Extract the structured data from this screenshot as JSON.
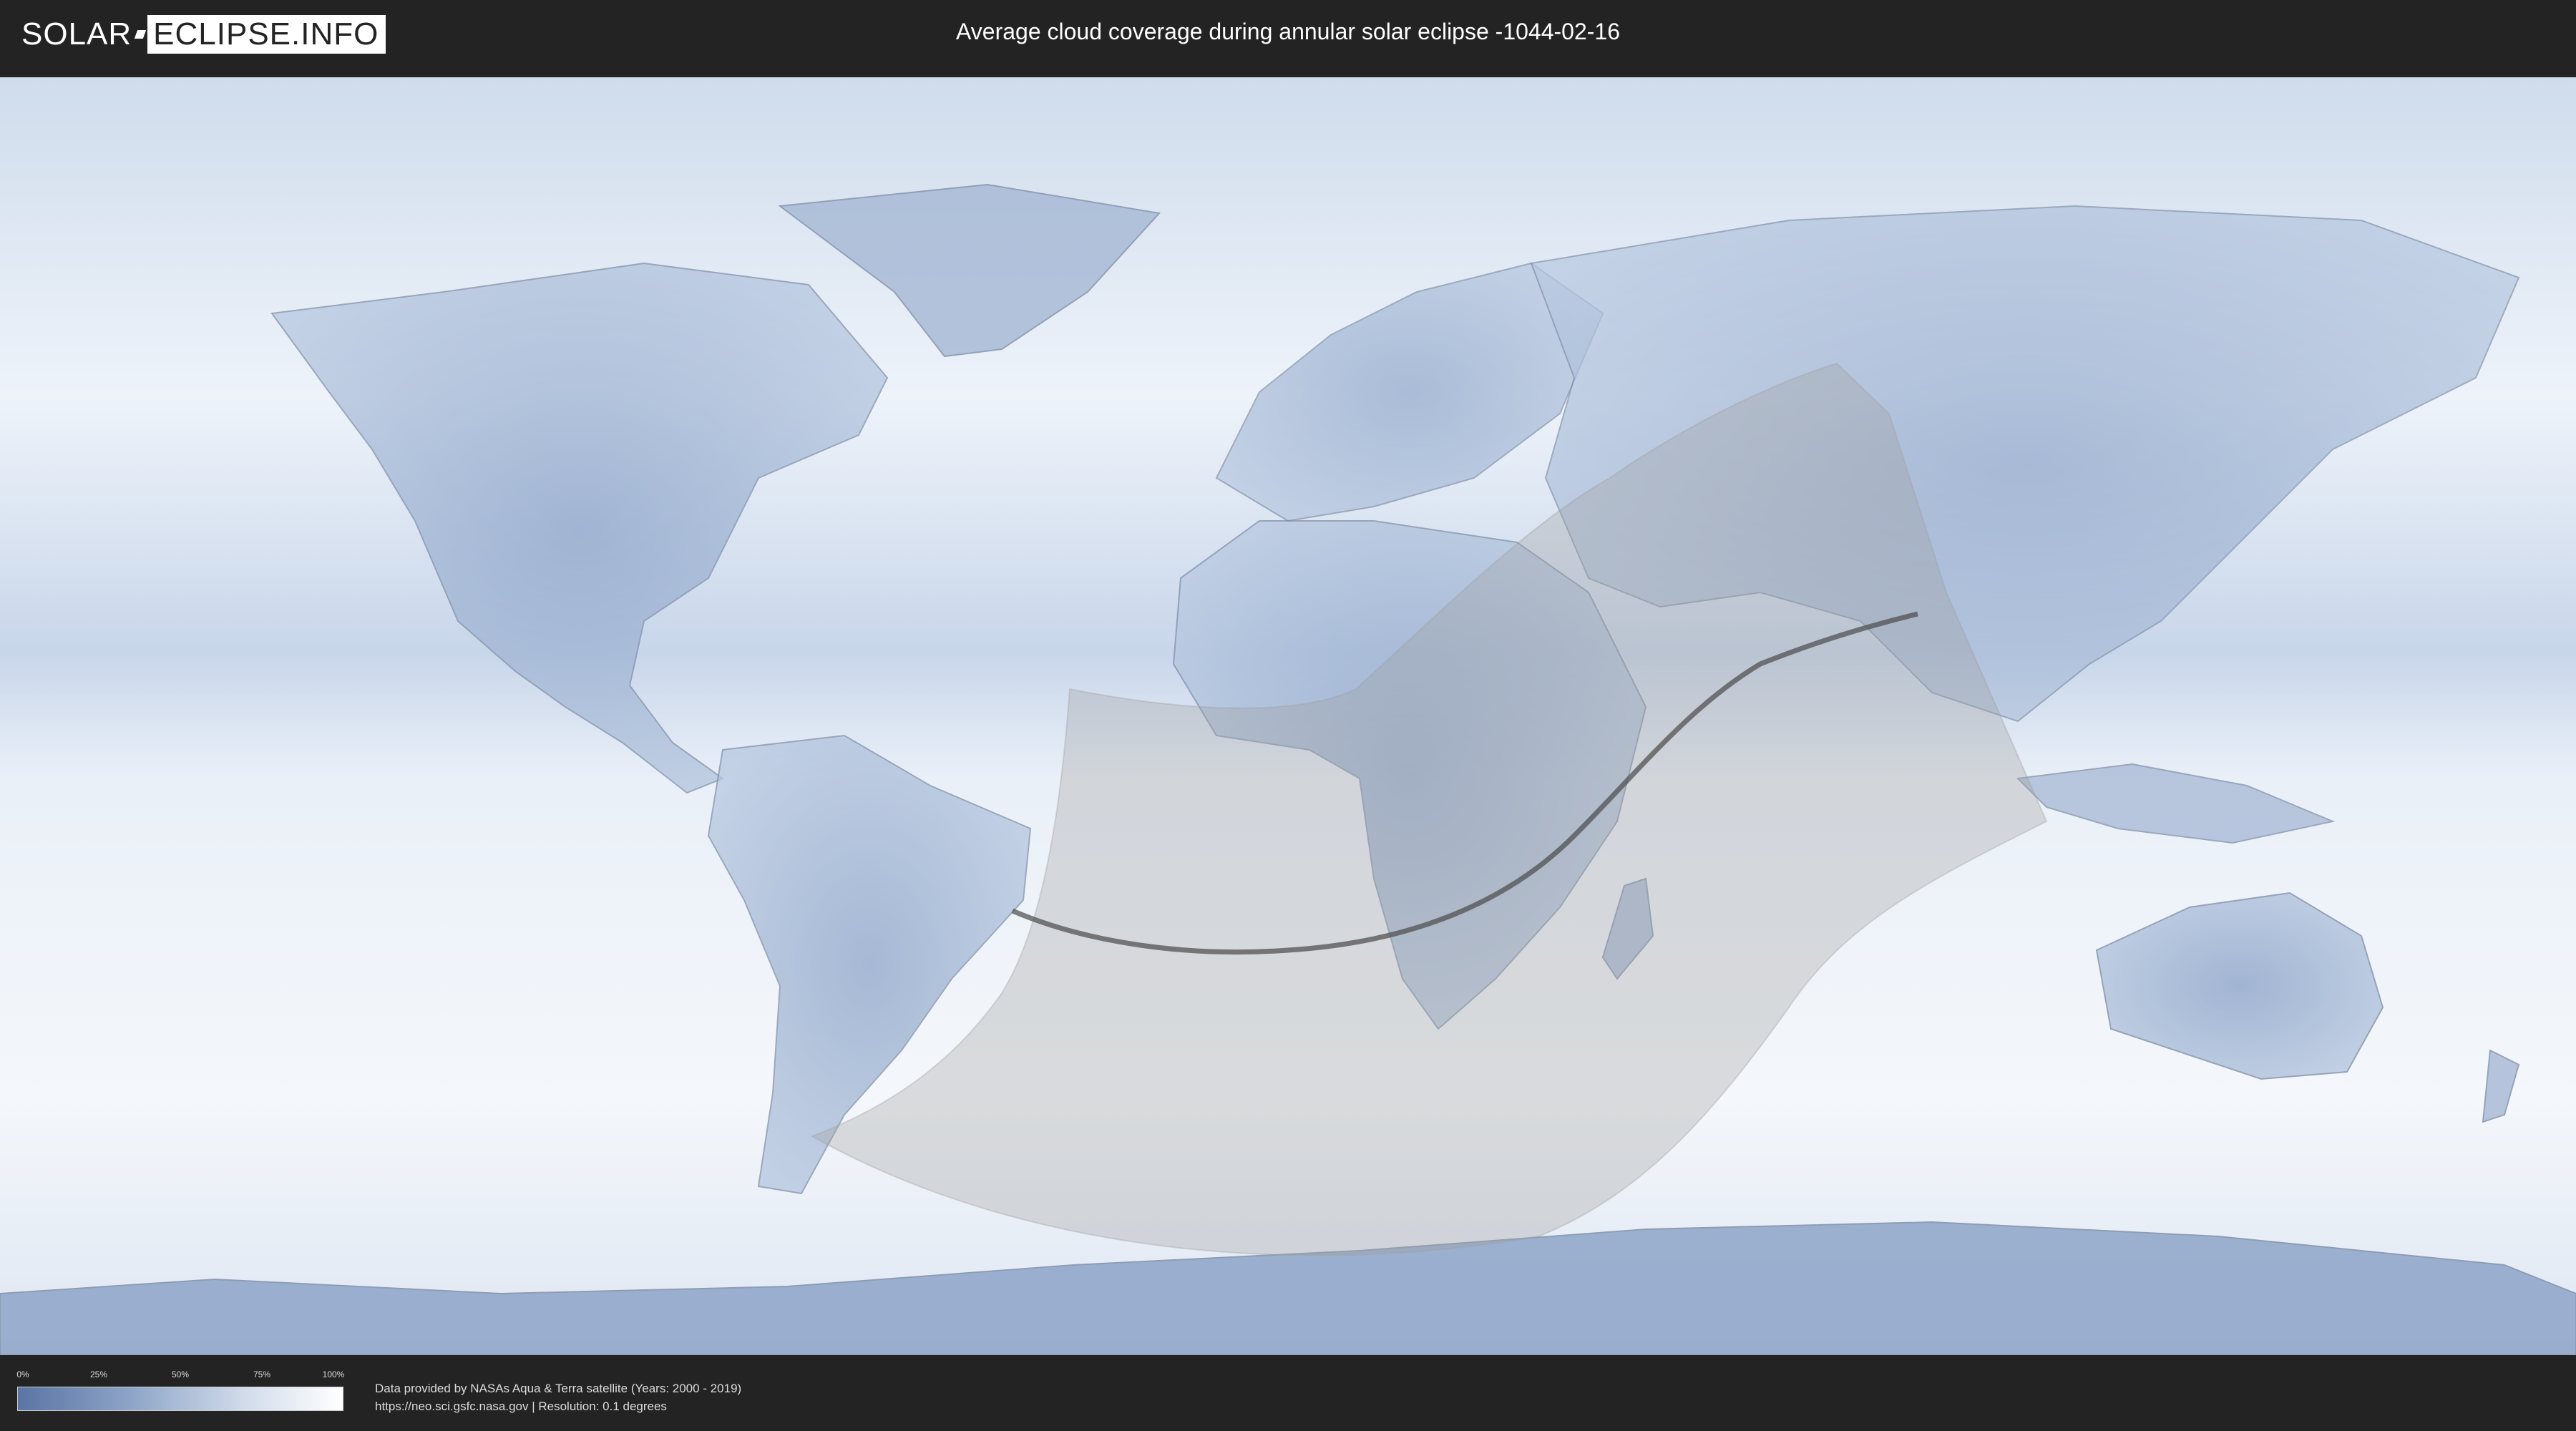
{
  "header": {
    "logo_part1": "SOLAR",
    "logo_part2": "ECLIPSE.INFO",
    "title": "Average cloud coverage during annular solar eclipse -1044-02-16"
  },
  "legend": {
    "ticks": [
      "0%",
      "25%",
      "50%",
      "75%",
      "100%"
    ],
    "colors": {
      "low": "#5a74a4",
      "mid": "#8ea5c7",
      "high": "#ffffff"
    }
  },
  "credits": {
    "line1": "Data provided by NASAs Aqua & Terra satellite (Years: 2000 - 2019)",
    "line2": "https://neo.sci.gsfc.nasa.gov | Resolution: 0.1 degrees"
  },
  "map": {
    "projection": "equirectangular",
    "eclipse_zone_color": "#a0a0a0",
    "central_line_color": "#4a4a4a"
  }
}
